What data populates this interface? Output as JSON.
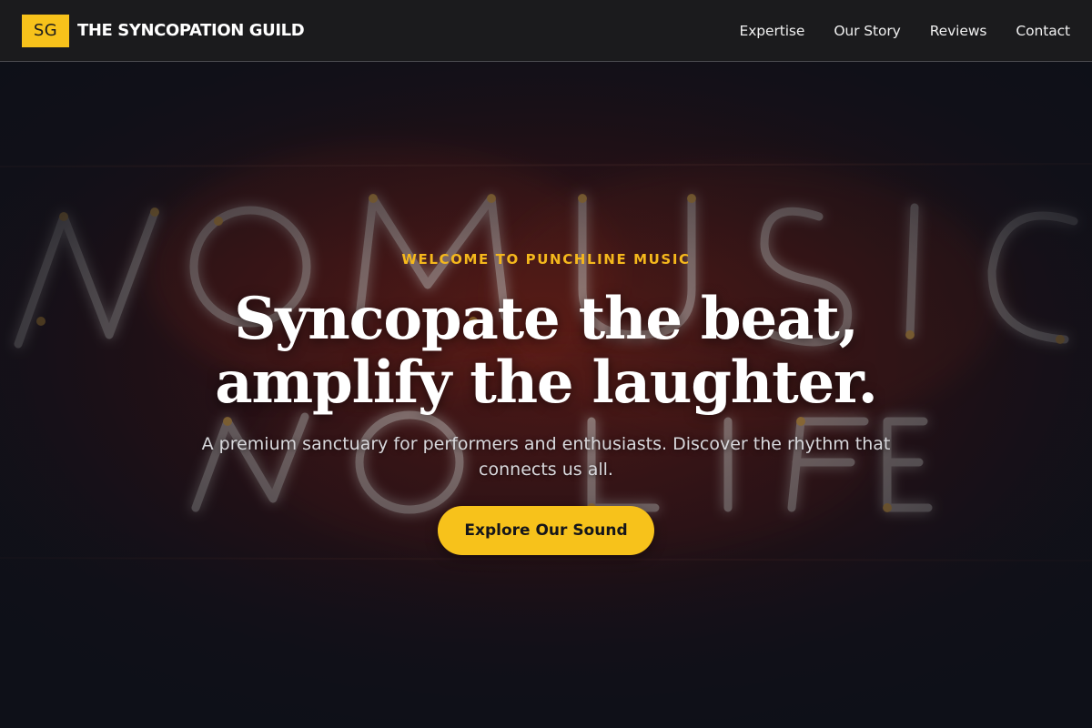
{
  "brand": {
    "logo_text": "SG",
    "name": "THE SYNCOPATION GUILD",
    "accent_color": "#f7c21b"
  },
  "nav": {
    "items": [
      "Expertise",
      "Our Story",
      "Reviews",
      "Contact"
    ]
  },
  "hero": {
    "eyebrow": "WELCOME TO PUNCHLINE MUSIC",
    "headline_line1": "Syncopate the beat,",
    "headline_line2": "amplify the laughter.",
    "subtitle": "A premium sanctuary for performers and enthusiasts. Discover the rhythm that connects us all.",
    "cta_label": "Explore Our Sound",
    "background_image": "neon sign reading NO MUSIC NO LIFE"
  }
}
